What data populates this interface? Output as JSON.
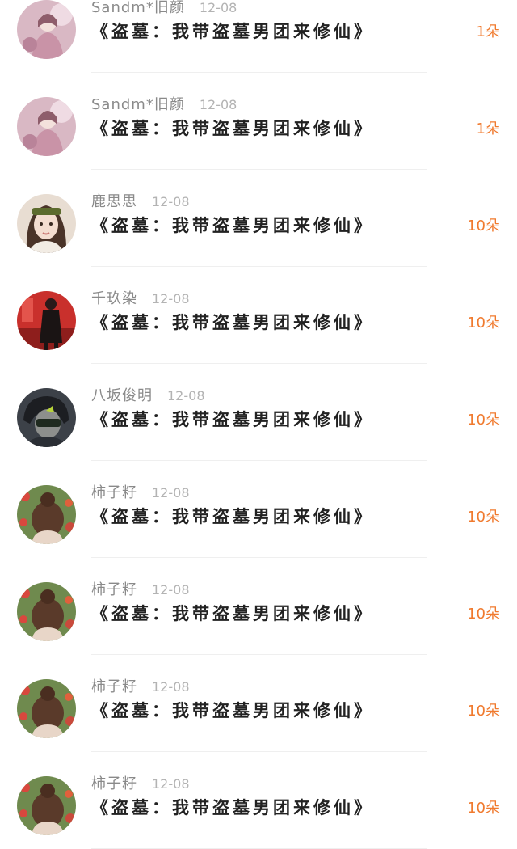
{
  "gift_color": "#f07a2e",
  "items": [
    {
      "username": "Sandm*旧颜",
      "date": "12-08",
      "title": "《盗墓：我带盗墓男团来修仙》",
      "gift": "1朵",
      "avatar": "pink-portrait"
    },
    {
      "username": "Sandm*旧颜",
      "date": "12-08",
      "title": "《盗墓：我带盗墓男团来修仙》",
      "gift": "1朵",
      "avatar": "pink-portrait"
    },
    {
      "username": "鹿思思",
      "date": "12-08",
      "title": "《盗墓：我带盗墓男团来修仙》",
      "gift": "10朵",
      "avatar": "headband-portrait"
    },
    {
      "username": "千玖染",
      "date": "12-08",
      "title": "《盗墓：我带盗墓男团来修仙》",
      "gift": "10朵",
      "avatar": "red-room-portrait"
    },
    {
      "username": "八坂俊明",
      "date": "12-08",
      "title": "《盗墓：我带盗墓男团来修仙》",
      "gift": "10朵",
      "avatar": "masked-portrait"
    },
    {
      "username": "柿子籽",
      "date": "12-08",
      "title": "《盗墓：我带盗墓男团来修仙》",
      "gift": "10朵",
      "avatar": "bun-hair-portrait"
    },
    {
      "username": "柿子籽",
      "date": "12-08",
      "title": "《盗墓：我带盗墓男团来修仙》",
      "gift": "10朵",
      "avatar": "bun-hair-portrait"
    },
    {
      "username": "柿子籽",
      "date": "12-08",
      "title": "《盗墓：我带盗墓男团来修仙》",
      "gift": "10朵",
      "avatar": "bun-hair-portrait"
    },
    {
      "username": "柿子籽",
      "date": "12-08",
      "title": "《盗墓：我带盗墓男团来修仙》",
      "gift": "10朵",
      "avatar": "bun-hair-portrait"
    }
  ]
}
